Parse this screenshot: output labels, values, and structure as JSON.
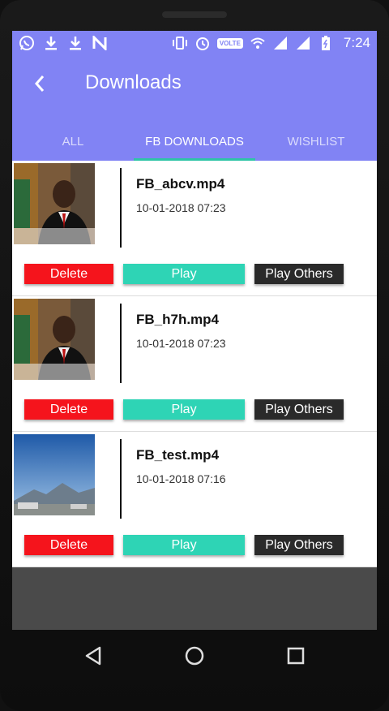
{
  "status_bar": {
    "left_icons": [
      "whatsapp-icon",
      "download-icon",
      "download-icon",
      "n-app-icon"
    ],
    "volte": "VOLTE",
    "time": "7:24"
  },
  "app_bar": {
    "title": "Downloads",
    "tabs": [
      {
        "label": "ALL",
        "active": false
      },
      {
        "label": "FB DOWNLOADS",
        "active": true
      },
      {
        "label": "WISHLIST",
        "active": false
      }
    ]
  },
  "items": [
    {
      "file": "FB_abcv.mp4",
      "date": "10-01-2018 07:23",
      "thumbnail": "person-video-thumbnail"
    },
    {
      "file": "FB_h7h.mp4",
      "date": "10-01-2018 07:23",
      "thumbnail": "person-video-thumbnail"
    },
    {
      "file": "FB_test.mp4",
      "date": "10-01-2018 07:16",
      "thumbnail": "landscape-video-thumbnail"
    }
  ],
  "buttons": {
    "delete": "Delete",
    "play": "Play",
    "play_others": "Play Others"
  },
  "colors": {
    "accent": "#8183f4",
    "tab_indicator": "#2ec4a6",
    "delete": "#f5141c",
    "play": "#2ed4b5",
    "play_others": "#2a2a2a"
  }
}
